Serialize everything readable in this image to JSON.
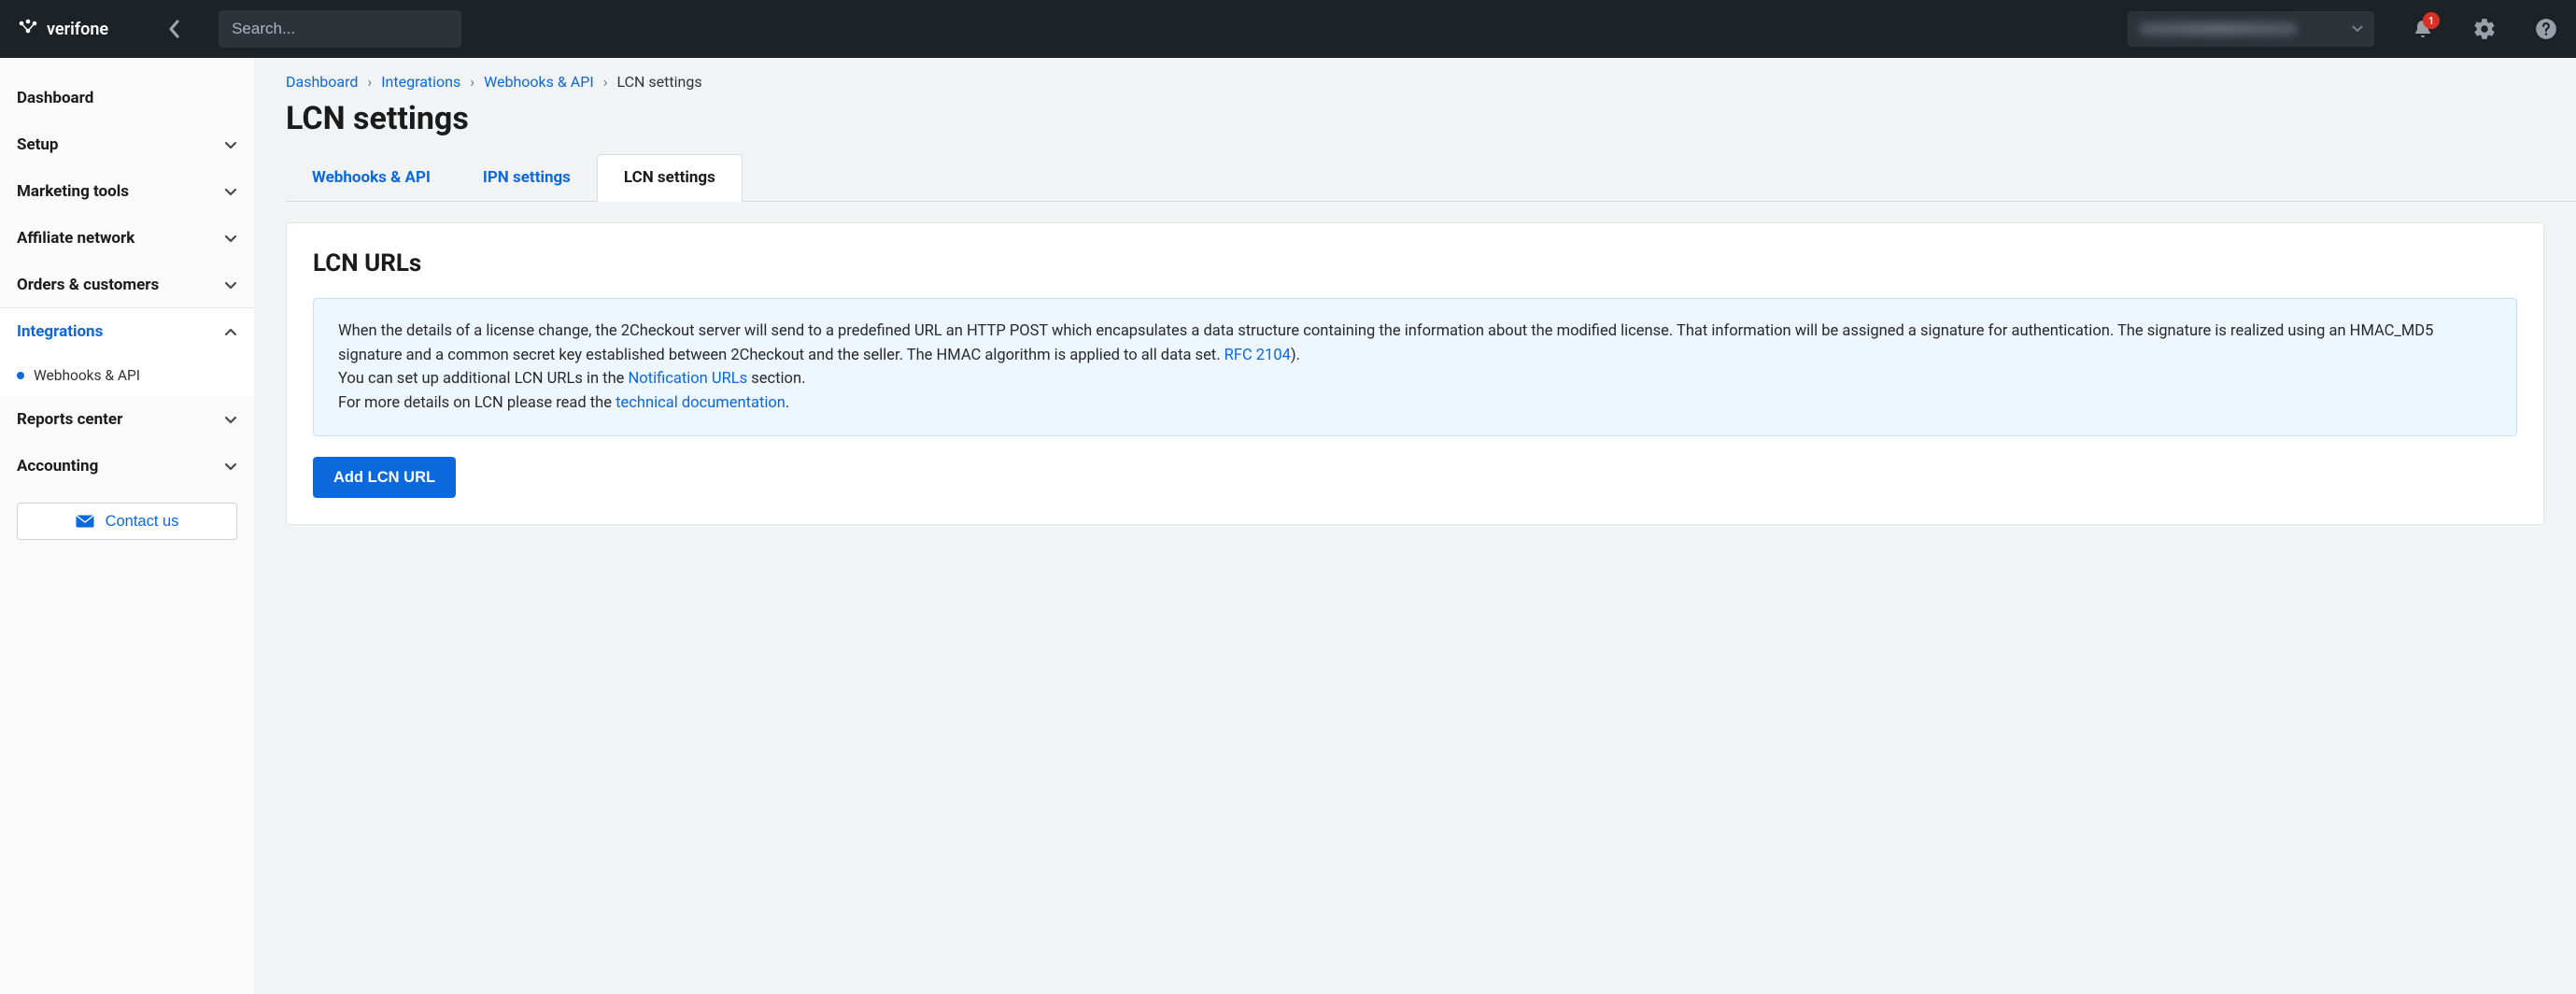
{
  "brand": {
    "name": "verifone"
  },
  "header": {
    "search_placeholder": "Search...",
    "notification_count": "1"
  },
  "sidebar": {
    "items": [
      {
        "label": "Dashboard",
        "expandable": false
      },
      {
        "label": "Setup",
        "expandable": true
      },
      {
        "label": "Marketing tools",
        "expandable": true
      },
      {
        "label": "Affiliate network",
        "expandable": true
      },
      {
        "label": "Orders & customers",
        "expandable": true
      },
      {
        "label": "Integrations",
        "expandable": true,
        "active": true
      },
      {
        "label": "Reports center",
        "expandable": true
      },
      {
        "label": "Accounting",
        "expandable": true
      }
    ],
    "integrations_sub": {
      "label": "Webhooks & API"
    },
    "contact_label": "Contact us"
  },
  "breadcrumbs": {
    "items": [
      {
        "label": "Dashboard"
      },
      {
        "label": "Integrations"
      },
      {
        "label": "Webhooks & API"
      }
    ],
    "current": "LCN settings"
  },
  "page": {
    "title": "LCN settings"
  },
  "tabs": {
    "items": [
      {
        "label": "Webhooks & API"
      },
      {
        "label": "IPN settings"
      },
      {
        "label": "LCN settings",
        "active": true
      }
    ]
  },
  "card": {
    "title": "LCN URLs",
    "info": {
      "line1_a": "When the details of a license change, the 2Checkout server will send to a predefined URL an HTTP POST which encapsulates a data structure containing the information about the modified license. That information will be assigned a signature for authentication. The signature is realized using an HMAC_MD5 signature and a common secret key established between 2Checkout and the seller. The HMAC algorithm is applied to all data set. ",
      "link1": "RFC 2104",
      "line1_b": ").",
      "line2_a": "You can set up additional LCN URLs in the ",
      "link2": "Notification URLs",
      "line2_b": " section.",
      "line3_a": "For more details on LCN please read the ",
      "link3": "technical documentation",
      "line3_b": "."
    },
    "add_button": "Add LCN URL"
  }
}
